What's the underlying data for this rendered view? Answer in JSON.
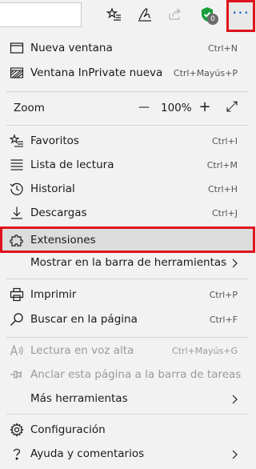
{
  "toolbar": {
    "badge_count": "0",
    "more_label": "···"
  },
  "menu": {
    "new_window": {
      "label": "Nueva ventana",
      "shortcut": "Ctrl+N"
    },
    "new_inprivate": {
      "label": "Ventana InPrivate nueva",
      "shortcut": "Ctrl+Mayús+P"
    },
    "zoom": {
      "label": "Zoom",
      "minus": "—",
      "value": "100%",
      "plus": "+",
      "fullscreen": "⤢"
    },
    "favorites": {
      "label": "Favoritos",
      "shortcut": "Ctrl+I"
    },
    "reading_list": {
      "label": "Lista de lectura",
      "shortcut": "Ctrl+M"
    },
    "history": {
      "label": "Historial",
      "shortcut": "Ctrl+H"
    },
    "downloads": {
      "label": "Descargas",
      "shortcut": "Ctrl+J"
    },
    "extensions": {
      "label": "Extensiones"
    },
    "show_in_toolbar": {
      "label": "Mostrar en la barra de herramientas"
    },
    "print": {
      "label": "Imprimir",
      "shortcut": "Ctrl+P"
    },
    "find": {
      "label": "Buscar en la página",
      "shortcut": "Ctrl+F"
    },
    "read_aloud": {
      "label": "Lectura en voz alta",
      "shortcut": "Ctrl+Mayús+G"
    },
    "pin_taskbar": {
      "label": "Anclar esta página a la barra de tareas"
    },
    "more_tools": {
      "label": "Más herramientas"
    },
    "settings": {
      "label": "Configuración"
    },
    "help": {
      "label": "Ayuda y comentarios"
    }
  },
  "colors": {
    "accent": "#1765c1",
    "highlight_border": "#e0121c",
    "shield": "#1a9e3c"
  }
}
